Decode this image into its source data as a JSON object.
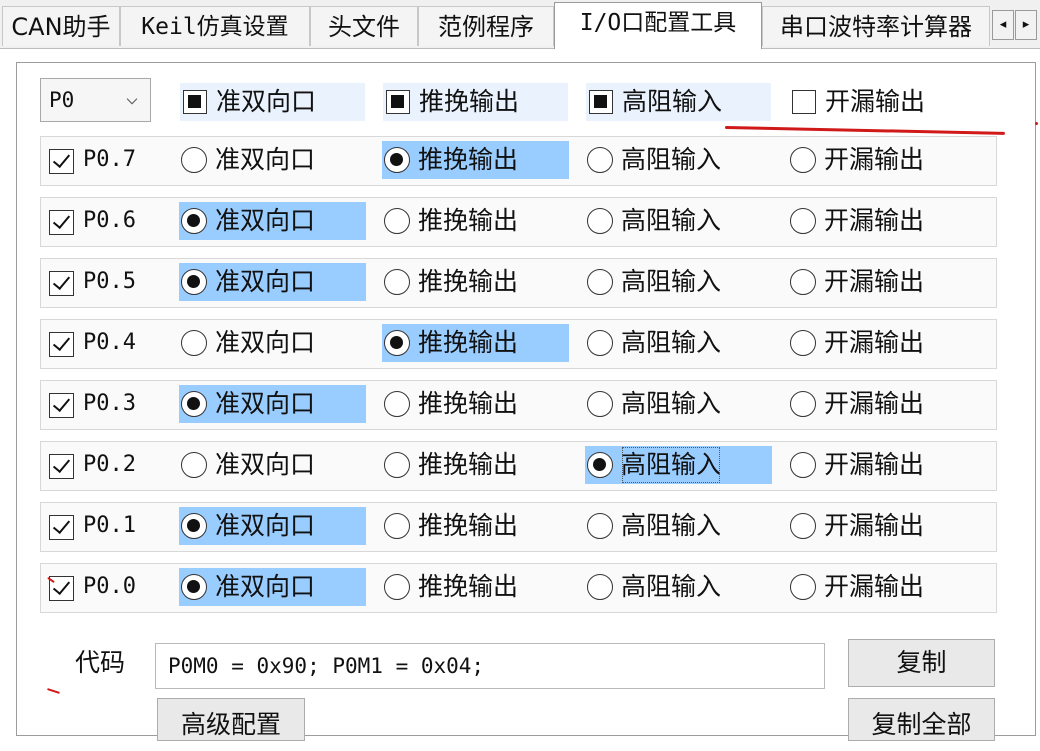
{
  "tabs": [
    {
      "label": "CAN助手",
      "active": false
    },
    {
      "label": "Keil仿真设置",
      "active": false
    },
    {
      "label": "头文件",
      "active": false
    },
    {
      "label": "范例程序",
      "active": false
    },
    {
      "label": "I/O口配置工具",
      "active": true
    },
    {
      "label": "串口波特率计算器",
      "active": false
    }
  ],
  "tab_scroll": {
    "left": "◂",
    "right": "▸"
  },
  "port_select": {
    "value": "P0"
  },
  "header_modes": [
    {
      "label": "准双向口",
      "state": "indeterminate"
    },
    {
      "label": "推挽输出",
      "state": "indeterminate"
    },
    {
      "label": "高阻输入",
      "state": "indeterminate"
    },
    {
      "label": "开漏输出",
      "state": "unchecked"
    }
  ],
  "pins": [
    {
      "label": "P0.7",
      "enabled": true,
      "mode": 1
    },
    {
      "label": "P0.6",
      "enabled": true,
      "mode": 0
    },
    {
      "label": "P0.5",
      "enabled": true,
      "mode": 0
    },
    {
      "label": "P0.4",
      "enabled": true,
      "mode": 1
    },
    {
      "label": "P0.3",
      "enabled": true,
      "mode": 0
    },
    {
      "label": "P0.2",
      "enabled": true,
      "mode": 2
    },
    {
      "label": "P0.1",
      "enabled": true,
      "mode": 0
    },
    {
      "label": "P0.0",
      "enabled": true,
      "mode": 0
    }
  ],
  "mode_labels": [
    "准双向口",
    "推挽输出",
    "高阻输入",
    "开漏输出"
  ],
  "code": {
    "label": "代码",
    "value": "P0M0 = 0x90; P0M1 = 0x04;"
  },
  "buttons": {
    "copy": "复制",
    "advanced": "高级配置",
    "copy_all": "复制全部"
  },
  "colors": {
    "selection": "#99ccff",
    "annotation": "#d01919"
  }
}
